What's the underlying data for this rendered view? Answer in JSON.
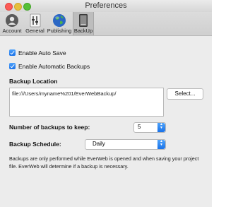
{
  "window": {
    "title": "Preferences"
  },
  "toolbar": {
    "items": [
      {
        "label": "Account",
        "icon": "account-icon"
      },
      {
        "label": "General",
        "icon": "general-icon"
      },
      {
        "label": "Publishing",
        "icon": "globe-icon"
      },
      {
        "label": "BackUp",
        "icon": "backup-device-icon",
        "selected": true
      }
    ]
  },
  "settings": {
    "auto_save_label": "Enable Auto Save",
    "auto_save_checked": true,
    "auto_backups_label": "Enable Automatic Backups",
    "auto_backups_checked": true,
    "backup_location_label": "Backup Location",
    "backup_location_value": "file:///Users/myname%201/EverWebBackup/",
    "select_button_label": "Select...",
    "backups_to_keep_label": "Number of backups to keep:",
    "backups_to_keep_value": "5",
    "backup_schedule_label": "Backup Schedule:",
    "backup_schedule_value": "Daily",
    "note": "Backups are only performed while EverWeb is opened and when saving your project file. EverWeb will determine if a backup is necessary."
  },
  "colors": {
    "accent": "#2e86f5",
    "close": "#fc5b57",
    "minimize": "#e5bf3c",
    "zoom": "#57c038"
  }
}
